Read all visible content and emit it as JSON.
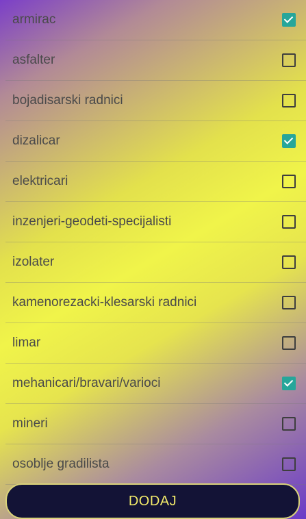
{
  "items": [
    {
      "label": "armirac",
      "checked": true
    },
    {
      "label": "asfalter",
      "checked": false
    },
    {
      "label": "bojadisarski radnici",
      "checked": false
    },
    {
      "label": "dizalicar",
      "checked": true
    },
    {
      "label": "elektricari",
      "checked": false
    },
    {
      "label": "inzenjeri-geodeti-specijalisti",
      "checked": false
    },
    {
      "label": "izolater",
      "checked": false
    },
    {
      "label": "kamenorezacki-klesarski radnici",
      "checked": false
    },
    {
      "label": "limar",
      "checked": false
    },
    {
      "label": "mehanicari/bravari/varioci",
      "checked": true
    },
    {
      "label": "mineri",
      "checked": false
    },
    {
      "label": "osoblje gradilista",
      "checked": false
    }
  ],
  "add_button_label": "DODAJ",
  "colors": {
    "accent": "#26a69a",
    "button_bg": "#131336",
    "button_text": "#f2ea6a"
  }
}
